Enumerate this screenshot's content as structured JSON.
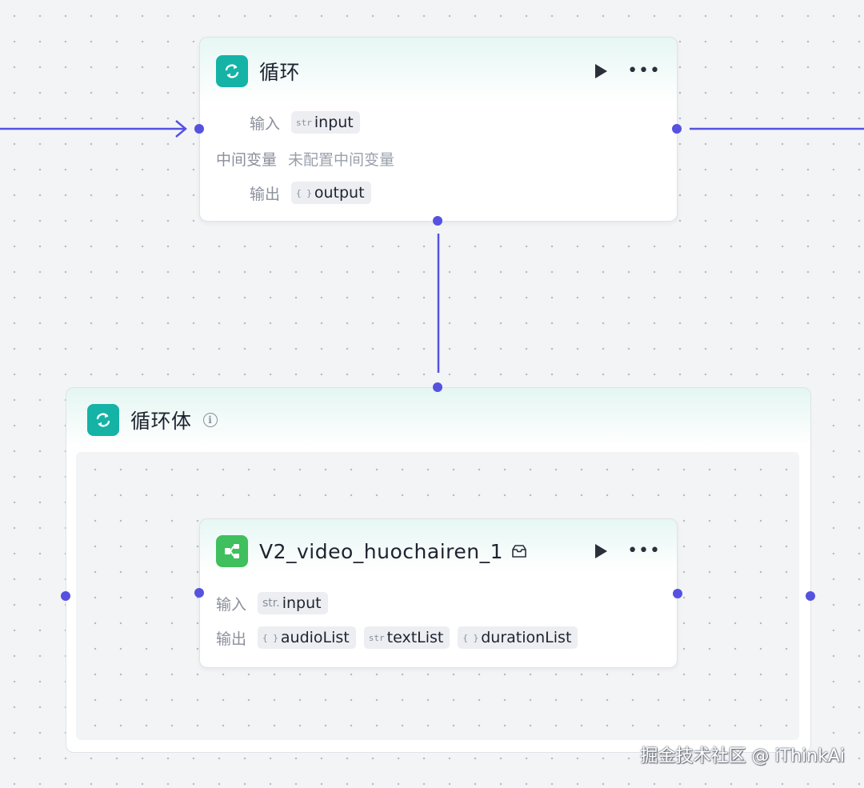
{
  "colors": {
    "edge": "#5552e0",
    "loop_icon": "#14b3a6",
    "plugin_icon": "#3fbf5d"
  },
  "loop_node": {
    "title": "循环",
    "icon": "loop-icon",
    "input_label": "输入",
    "input_type": "str",
    "input_name": "input",
    "intermediate_label": "中间变量",
    "intermediate_value": "未配置中间变量",
    "output_label": "输出",
    "output_type": "{ }",
    "output_name": "output"
  },
  "loop_body": {
    "title": "循环体",
    "icon": "loop-icon"
  },
  "plugin_node": {
    "title": "V2_video_huochairen_1",
    "icon": "plugin-icon",
    "input_label": "输入",
    "input_type": "str.",
    "input_name": "input",
    "output_label": "输出",
    "outputs": [
      {
        "type": "{ }",
        "name": "audioList"
      },
      {
        "type": "str",
        "name": "textList"
      },
      {
        "type": "{ }",
        "name": "durationList"
      }
    ]
  },
  "watermark": "掘金技术社区 @ iThinkAi"
}
